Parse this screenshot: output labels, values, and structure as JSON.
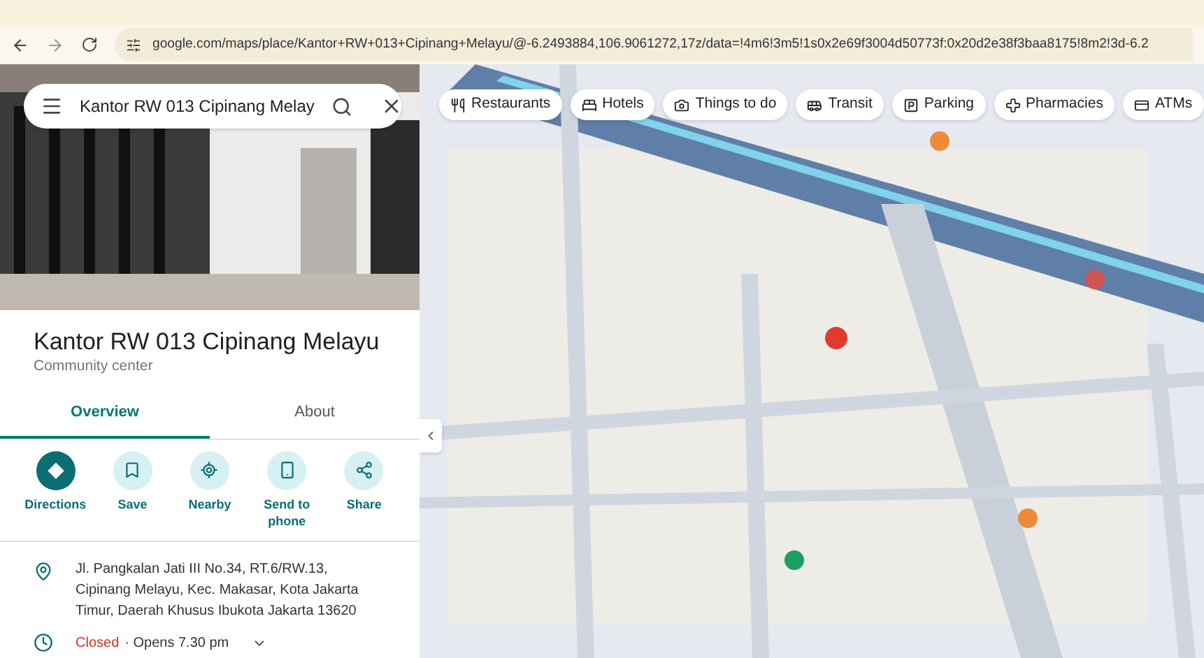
{
  "browser": {
    "url": "google.com/maps/place/Kantor+RW+013+Cipinang+Melayu/@-6.2493884,106.9061272,17z/data=!4m6!3m5!1s0x2e69f3004d50773f:0x20d2e38f3baa8175!8m2!3d-6.2"
  },
  "search": {
    "value": "Kantor RW 013 Cipinang Melay"
  },
  "place": {
    "title": "Kantor RW 013 Cipinang Melayu",
    "category": "Community center"
  },
  "tabs": [
    {
      "label": "Overview",
      "selected": true
    },
    {
      "label": "About",
      "selected": false
    }
  ],
  "actions": [
    {
      "kind": "directions",
      "label": "Directions",
      "primary": true
    },
    {
      "kind": "save",
      "label": "Save",
      "primary": false
    },
    {
      "kind": "nearby",
      "label": "Nearby",
      "primary": false
    },
    {
      "kind": "send",
      "label": "Send to phone",
      "primary": false
    },
    {
      "kind": "share",
      "label": "Share",
      "primary": false
    }
  ],
  "details": {
    "address": "Jl. Pangkalan Jati III No.34, RT.6/RW.13, Cipinang Melayu, Kec. Makasar, Kota Jakarta Timur, Daerah Khusus Ibukota Jakarta 13620",
    "hours_status": "Closed",
    "hours_text": "· Opens 7.30 pm"
  },
  "chips": [
    {
      "kind": "restaurants",
      "label": "Restaurants"
    },
    {
      "kind": "hotels",
      "label": "Hotels"
    },
    {
      "kind": "things",
      "label": "Things to do"
    },
    {
      "kind": "transit",
      "label": "Transit"
    },
    {
      "kind": "parking",
      "label": "Parking"
    },
    {
      "kind": "pharmacies",
      "label": "Pharmacies"
    },
    {
      "kind": "atms",
      "label": "ATMs"
    }
  ]
}
